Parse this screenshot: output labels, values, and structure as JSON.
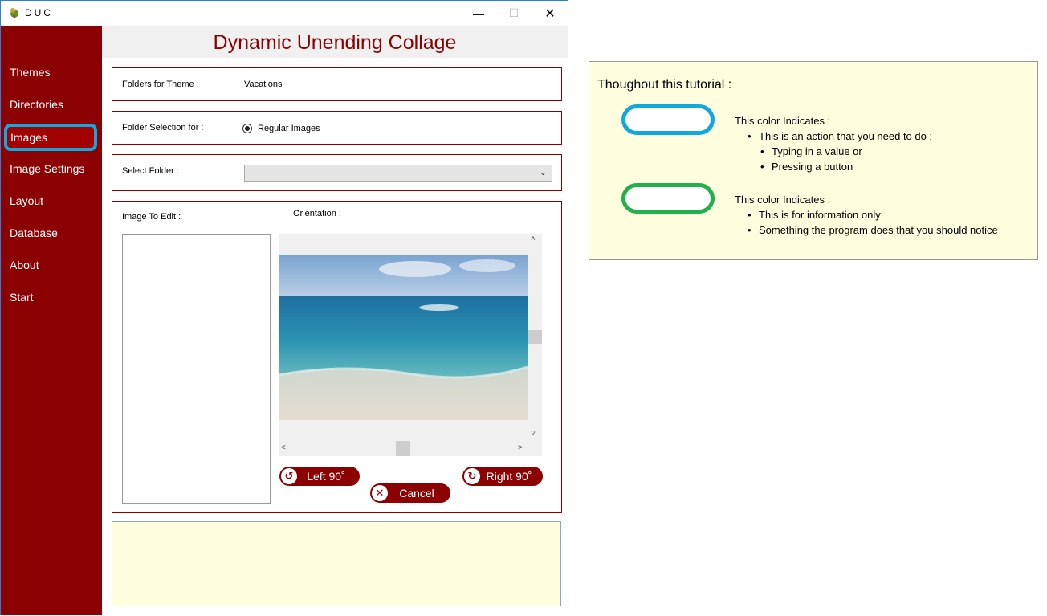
{
  "window": {
    "title": "DUC",
    "minimize": "—",
    "maximize": "☐",
    "close": "✕"
  },
  "sidebar": {
    "items": [
      {
        "label": "Themes"
      },
      {
        "label": "Directories"
      },
      {
        "label": "Images"
      },
      {
        "label": "Image Settings"
      },
      {
        "label": "Layout"
      },
      {
        "label": "Database"
      },
      {
        "label": "About"
      },
      {
        "label": "Start"
      }
    ],
    "selected": "Images"
  },
  "header": {
    "title": "Dynamic Unending Collage"
  },
  "form": {
    "folders_label": "Folders for Theme :",
    "folders_value": "Vacations",
    "selection_label": "Folder Selection for :",
    "selection_option": "Regular Images",
    "select_folder_label": "Select Folder :",
    "select_folder_value": "",
    "image_to_edit_label": "Image To Edit :",
    "orientation_label": "Orientation :"
  },
  "buttons": {
    "left": "Left 90˚",
    "right": "Right 90˚",
    "cancel": "Cancel"
  },
  "legend": {
    "title": "Thoughout this tutorial :",
    "blue": {
      "color": "#10a8e0",
      "heading": "This color Indicates :",
      "line1": "This is an action that you need to do :",
      "sub1": "Typing in a value or",
      "sub2": "Pressing a button"
    },
    "green": {
      "color": "#22b04a",
      "heading": "This color Indicates :",
      "line1": "This is for information only",
      "line2": "Something the program does that you should notice"
    }
  },
  "colors": {
    "accent": "#8b0000",
    "info_bg": "#ffffe0"
  }
}
